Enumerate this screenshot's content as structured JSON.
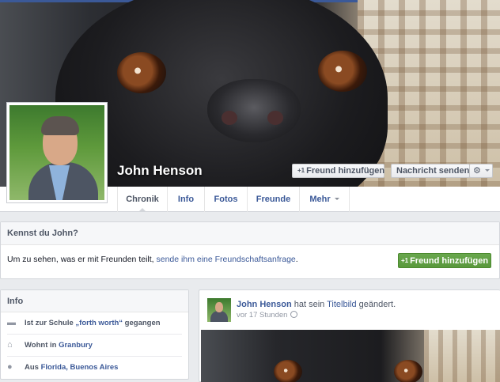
{
  "profile": {
    "name": "John Henson",
    "add_friend_label": "Freund hinzufügen",
    "message_label": "Nachricht senden"
  },
  "nav": {
    "tabs": [
      "Chronik",
      "Info",
      "Fotos",
      "Freunde",
      "Mehr"
    ],
    "active": "Chronik"
  },
  "know": {
    "title": "Kennst du John?",
    "text": "Um zu sehen, was er mit Freunden teilt, ",
    "link": "sende ihm eine Freundschaftsanfrage",
    "suffix": ".",
    "button": "Freund hinzufügen"
  },
  "info": {
    "title": "Info",
    "items": [
      {
        "icon": "school-icon",
        "prefix": "Ist zur Schule ",
        "link": "„forth worth“",
        "suffix": " gegangen"
      },
      {
        "icon": "home-icon",
        "prefix": "Wohnt in ",
        "link": "Granbury",
        "suffix": ""
      },
      {
        "icon": "location-pin-icon",
        "prefix": "Aus ",
        "link": "Florida, Buenos Aires",
        "suffix": ""
      }
    ]
  },
  "post": {
    "author": "John Henson",
    "action": " hat sein ",
    "object": "Titelbild",
    "action_end": " geändert.",
    "time": "vor 17 Stunden"
  },
  "colors": {
    "brand": "#3b5998",
    "green_button": "#5b9a3e"
  }
}
